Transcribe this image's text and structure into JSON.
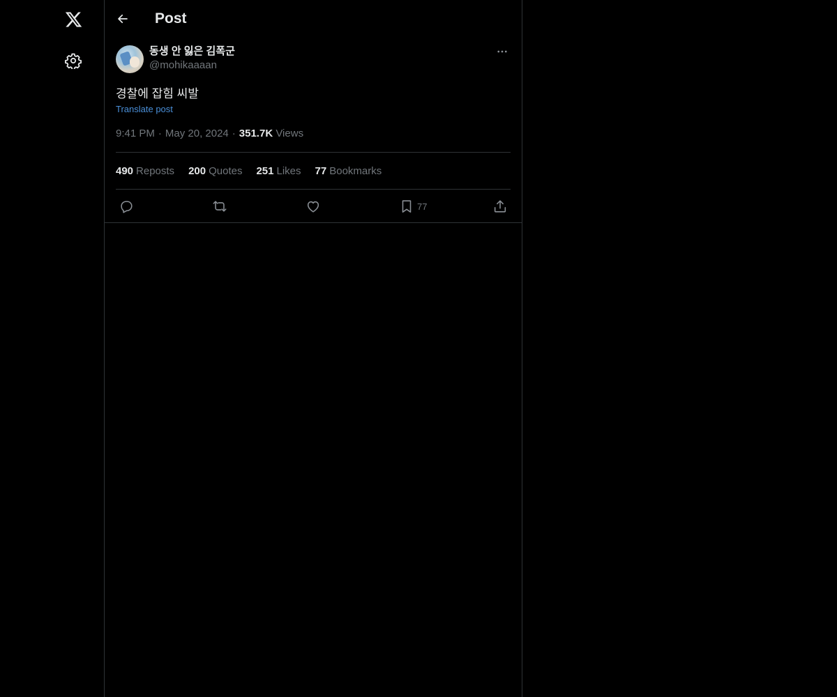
{
  "header": {
    "title": "Post"
  },
  "post": {
    "author_name": "동생 안 잃은 김폭군",
    "author_handle": "@mohikaaaan",
    "text": "경찰에 잡힘 씨발",
    "translate_label": "Translate post",
    "time": "9:41 PM",
    "date": "May 20, 2024",
    "views_count": "351.7K",
    "views_label": "Views"
  },
  "stats": {
    "reposts_count": "490",
    "reposts_label": "Reposts",
    "quotes_count": "200",
    "quotes_label": "Quotes",
    "likes_count": "251",
    "likes_label": "Likes",
    "bookmarks_count": "77",
    "bookmarks_label": "Bookmarks"
  },
  "actions": {
    "bookmark_count": "77"
  },
  "icons": {
    "logo": "x-logo-icon",
    "settings": "gear-icon",
    "back": "arrow-left-icon",
    "more": "more-horizontal-icon",
    "reply": "reply-icon",
    "repost": "repost-icon",
    "like": "heart-icon",
    "bookmark": "bookmark-icon",
    "share": "share-icon"
  },
  "colors": {
    "background": "#000000",
    "text_primary": "#e7e9ea",
    "text_secondary": "#71767b",
    "border": "#2f3336",
    "link": "#4a8fd8"
  }
}
